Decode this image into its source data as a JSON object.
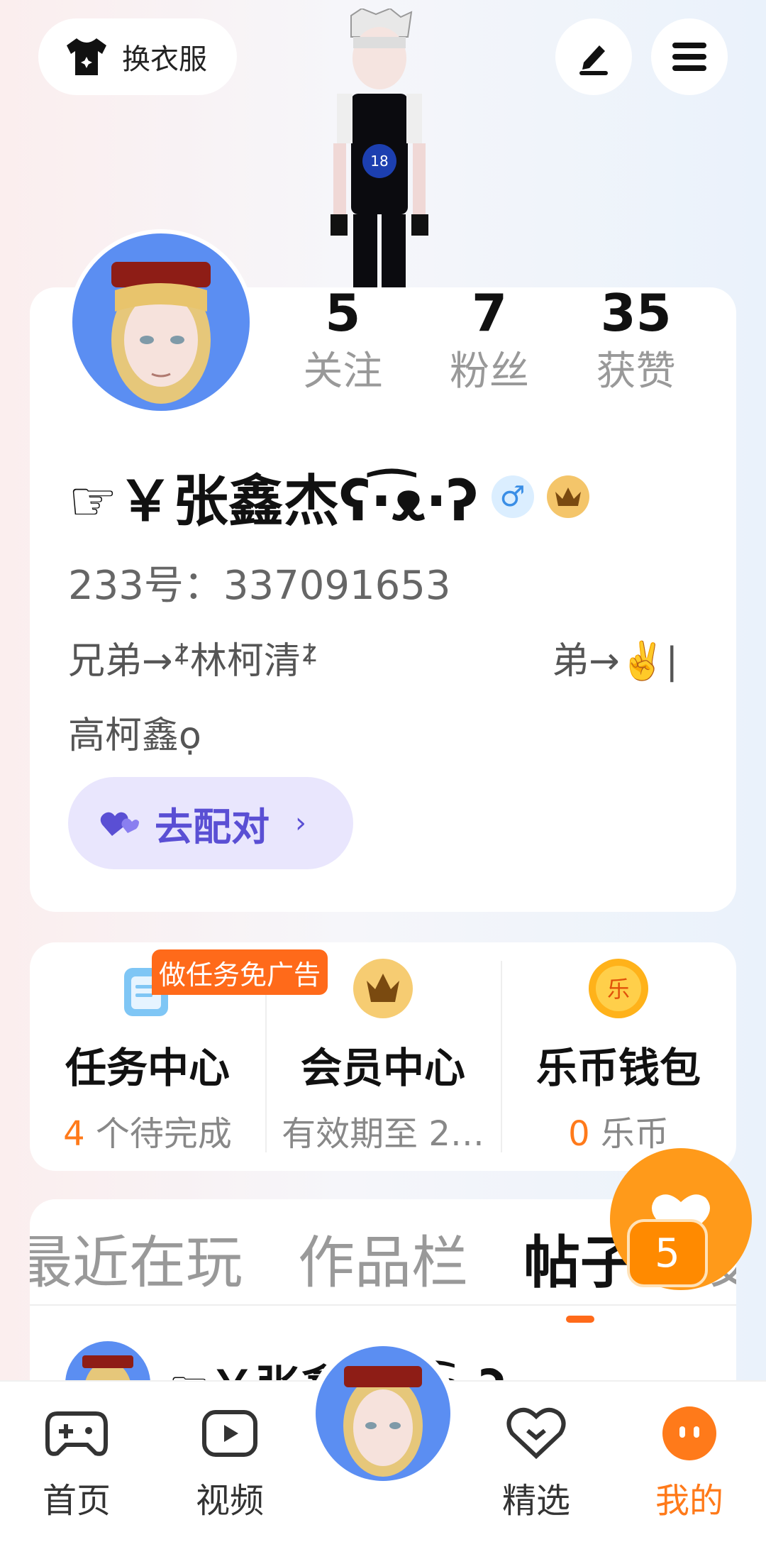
{
  "header": {
    "dress_up_label": "换衣服"
  },
  "profile": {
    "stats": [
      {
        "value": "5",
        "label": "关注"
      },
      {
        "value": "7",
        "label": "粉丝"
      },
      {
        "value": "35",
        "label": "获赞"
      }
    ],
    "name": "☞￥张鑫杰ʕ·͡ᴥ·ʔ",
    "gender_badge": "♂",
    "uid": "233号：337091653",
    "bio_line1_left": "兄弟→ᙇ林柯清ᙇ",
    "bio_line1_right": "弟→✌️|",
    "bio_line2": "高柯鑫ọ",
    "pair_button": "去配对"
  },
  "services": [
    {
      "title": "任务中心",
      "count": "4",
      "sub": " 个待完成",
      "tag": "做任务免广告"
    },
    {
      "title": "会员中心",
      "sub": "有效期至 2…"
    },
    {
      "title": "乐币钱包",
      "count": "0",
      "sub": " 乐币",
      "icon_char": "乐"
    }
  ],
  "tabs": [
    "最近在玩",
    "作品栏",
    "帖子",
    "设"
  ],
  "post_preview_name": "☞￥张鑫杰ʕ·͡ᴥ·ʔ",
  "float_badge": "5",
  "nav": [
    {
      "label": "首页"
    },
    {
      "label": "视频"
    },
    {
      "label": "精选"
    },
    {
      "label": "我的"
    }
  ],
  "colors": {
    "accent": "#ff7a1a",
    "pair": "#5a4fd4",
    "avatar_bg": "#5b8ef2"
  }
}
